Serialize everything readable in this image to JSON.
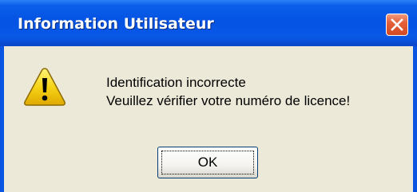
{
  "window": {
    "title": "Information Utilisateur"
  },
  "message": {
    "line1": "Identification incorrecte",
    "line2": "Veuillez vérifier votre numéro de licence!"
  },
  "buttons": {
    "ok_label": "OK"
  },
  "icons": {
    "dialog_icon": "warning-icon",
    "close_icon": "close-icon"
  },
  "colors": {
    "titlebar": "#0553e4",
    "client_bg": "#ece9d8",
    "close_button": "#e5603a",
    "warning_yellow": "#f7d418"
  }
}
